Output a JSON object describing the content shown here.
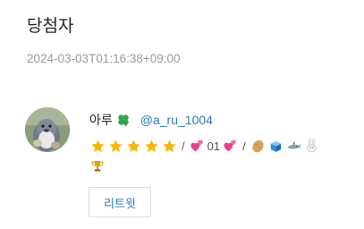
{
  "page": {
    "title": "당첨자",
    "timestamp": "2024-03-03T01:16:38+09:00"
  },
  "winner": {
    "display_name": "아루",
    "name_badge_icon": "four-leaf-clover",
    "handle": "@a_ru_1004",
    "bio": {
      "stars_icon": "star",
      "separator": "/",
      "count_text": "01",
      "heart_icon": "two-hearts",
      "items_icons": [
        "potato",
        "ice-cube",
        "shark",
        "rabbit"
      ],
      "trophy_icon": "trophy"
    }
  },
  "actions": {
    "retweet_label": "리트윗"
  },
  "colors": {
    "link": "#2b7bc8",
    "star": "#f5b700",
    "heart": "#e6408f",
    "muted": "#9a9a9a"
  }
}
